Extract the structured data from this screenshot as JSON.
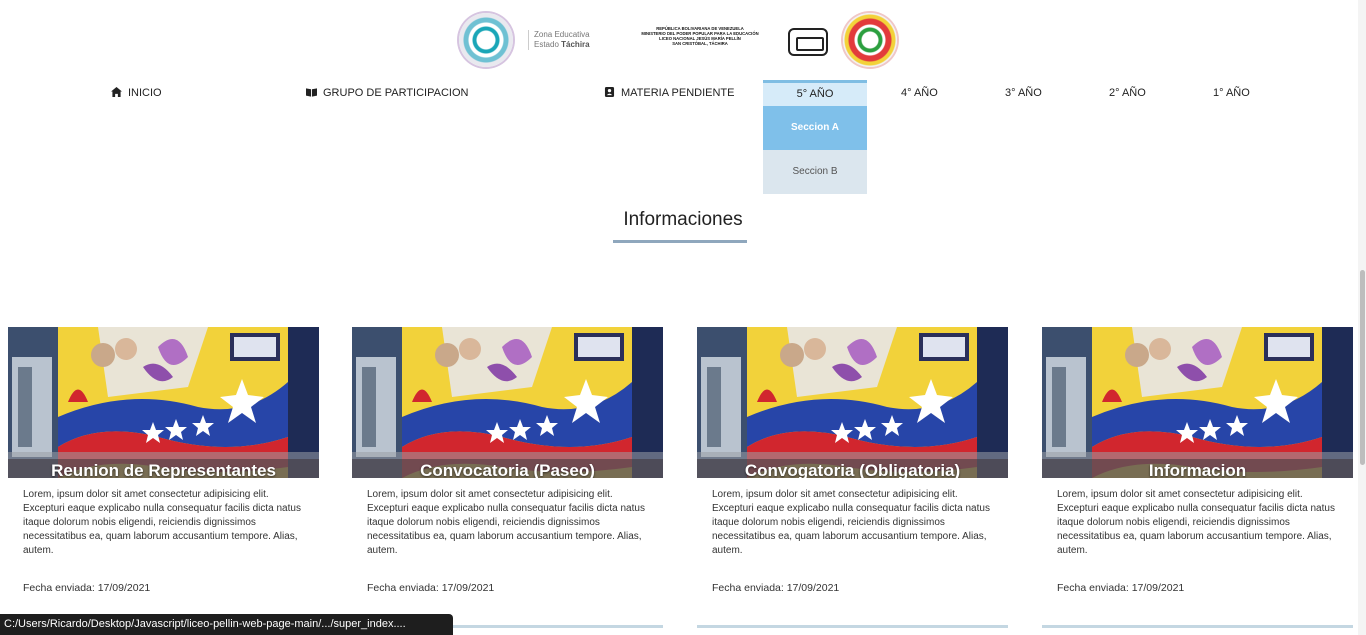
{
  "header": {
    "zona_line1": "Zona Educativa",
    "zona_line2_prefix": "Estado",
    "zona_line2_bold": "Táchira",
    "ministry_lines": [
      "REPÚBLICA BOLIVARIANA DE VENEZUELA",
      "MINISTERIO DEL PODER POPULAR PARA LA EDUCACIÓN",
      "LICEO NACIONAL JESÚS MARÍA PELLÍN",
      "SAN CRISTÓBAL, TÁCHIRA"
    ]
  },
  "nav": {
    "inicio": "INICIO",
    "grupo": "GRUPO DE PARTICIPACION",
    "materia": "MATERIA PENDIENTE",
    "quinto": "5° AÑO",
    "cuarto": "4° AÑO",
    "tercero": "3° AÑO",
    "segundo": "2° AÑO",
    "primero": "1° AÑO"
  },
  "dropdown": {
    "seccion_a": "Seccion A",
    "seccion_b": "Seccion B"
  },
  "section": {
    "title": "Informaciones"
  },
  "cards": [
    {
      "title": "Reunion de Representantes",
      "body": "Lorem, ipsum dolor sit amet consectetur adipisicing elit. Excepturi eaque explicabo nulla consequatur facilis dicta natus itaque dolorum nobis eligendi, reiciendis dignissimos necessitatibus ea, quam laborum accusantium tempore. Alias, autem.",
      "date": "Fecha enviada: 17/09/2021"
    },
    {
      "title": "Convocatoria (Paseo)",
      "body": "Lorem, ipsum dolor sit amet consectetur adipisicing elit. Excepturi eaque explicabo nulla consequatur facilis dicta natus itaque dolorum nobis eligendi, reiciendis dignissimos necessitatibus ea, quam laborum accusantium tempore. Alias, autem.",
      "date": "Fecha enviada: 17/09/2021"
    },
    {
      "title": "Convogatoria (Obligatoria)",
      "body": "Lorem, ipsum dolor sit amet consectetur adipisicing elit. Excepturi eaque explicabo nulla consequatur facilis dicta natus itaque dolorum nobis eligendi, reiciendis dignissimos necessitatibus ea, quam laborum accusantium tempore. Alias, autem.",
      "date": "Fecha enviada: 17/09/2021"
    },
    {
      "title": "Informacion",
      "body": "Lorem, ipsum dolor sit amet consectetur adipisicing elit. Excepturi eaque explicabo nulla consequatur facilis dicta natus itaque dolorum nobis eligendi, reiciendis dignissimos necessitatibus ea, quam laborum accusantium tempore. Alias, autem.",
      "date": "Fecha enviada: 17/09/2021"
    }
  ],
  "status_bar": {
    "url": "C:/Users/Ricardo/Desktop/Javascript/liceo-pellin-web-page-main/.../super_index...."
  },
  "icons": {
    "inicio": "home-icon",
    "grupo": "book-icon",
    "materia": "contact-card-icon"
  },
  "colors": {
    "nav_active_bg": "#d6ebf9",
    "nav_active_border": "#7fbde3",
    "dropdown_a_bg": "#7fc0ea",
    "dropdown_b_bg": "#dbe6ee",
    "title_underline": "#8fa7bd"
  }
}
